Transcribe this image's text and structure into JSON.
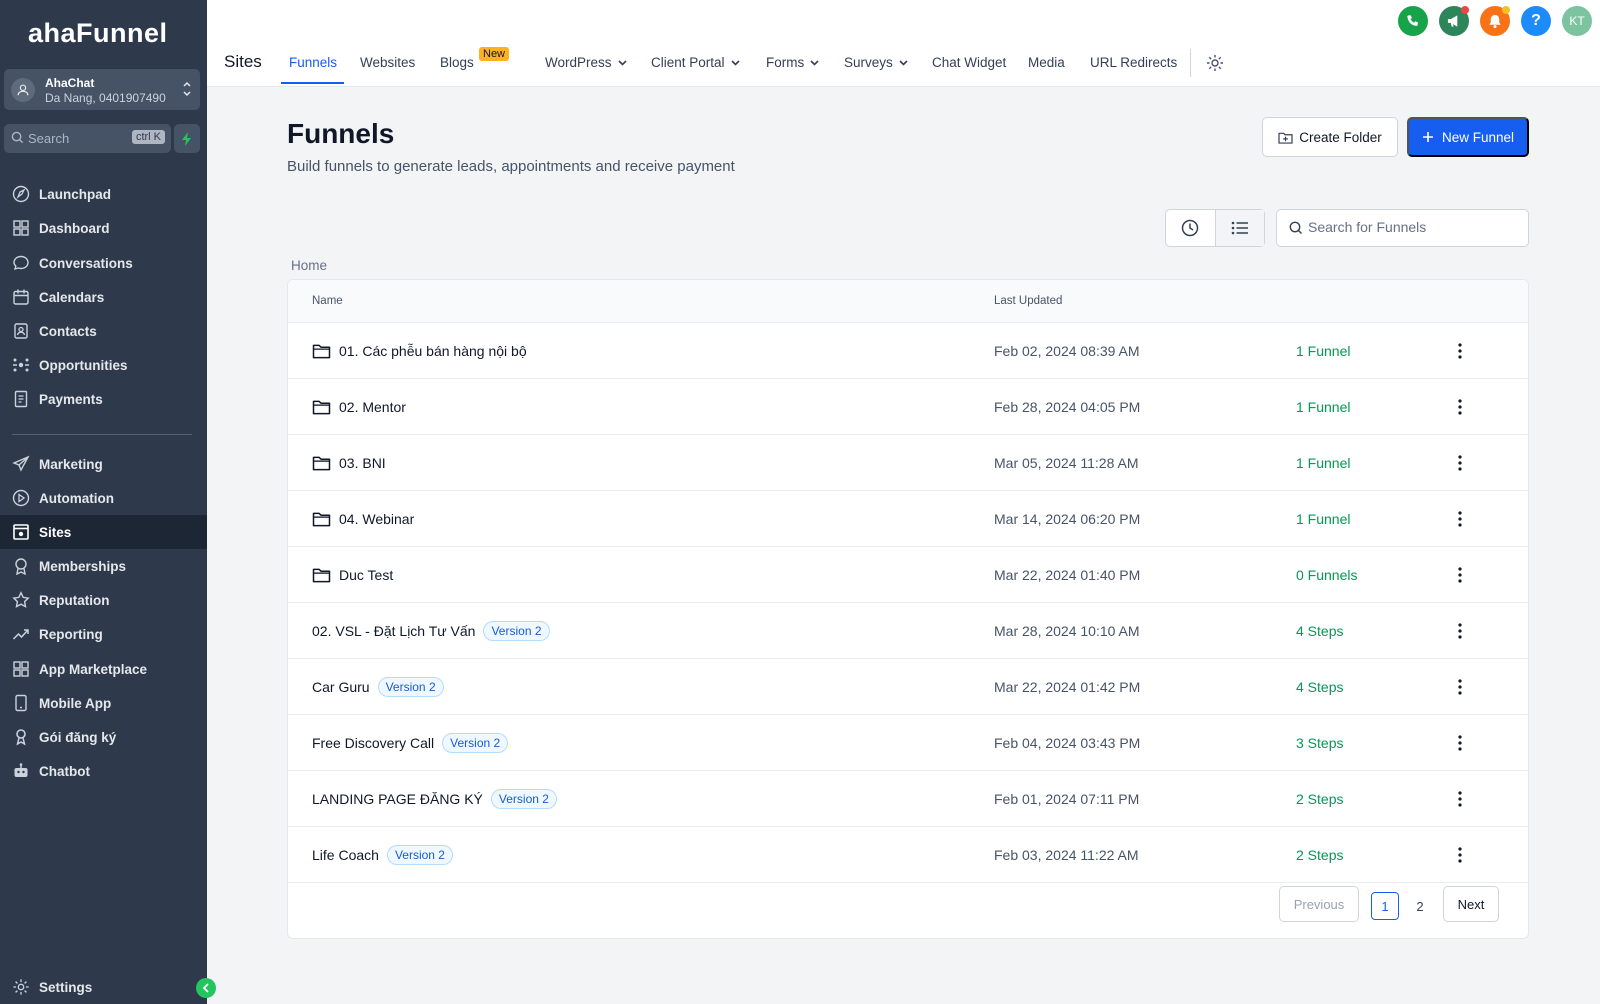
{
  "brand": {
    "logo_text": "ahaFunnel"
  },
  "account": {
    "name": "AhaChat",
    "location": "Da Nang, 0401907490"
  },
  "sidebar_search": {
    "label": "Search",
    "shortcut": "ctrl K"
  },
  "sidebar": {
    "items": [
      {
        "label": "Launchpad",
        "icon": "rocket-icon"
      },
      {
        "label": "Dashboard",
        "icon": "grid-icon"
      },
      {
        "label": "Conversations",
        "icon": "chat-icon"
      },
      {
        "label": "Calendars",
        "icon": "calendar-icon"
      },
      {
        "label": "Contacts",
        "icon": "contacts-icon"
      },
      {
        "label": "Opportunities",
        "icon": "opportunities-icon"
      },
      {
        "label": "Payments",
        "icon": "payments-icon"
      },
      {
        "label": "Marketing",
        "icon": "send-icon"
      },
      {
        "label": "Automation",
        "icon": "automation-icon"
      },
      {
        "label": "Sites",
        "icon": "sites-icon"
      },
      {
        "label": "Memberships",
        "icon": "badge-icon"
      },
      {
        "label": "Reputation",
        "icon": "star-icon"
      },
      {
        "label": "Reporting",
        "icon": "trend-icon"
      },
      {
        "label": "App Marketplace",
        "icon": "apps-icon"
      },
      {
        "label": "Mobile App",
        "icon": "mobile-icon"
      },
      {
        "label": "Gói đăng ký",
        "icon": "subscription-icon"
      },
      {
        "label": "Chatbot",
        "icon": "robot-icon"
      }
    ],
    "active": "Sites",
    "settings_label": "Settings"
  },
  "topbar": {
    "section": "Sites",
    "tabs": [
      {
        "label": "Funnels",
        "active": true
      },
      {
        "label": "Websites"
      },
      {
        "label": "Blogs",
        "badge": "New"
      },
      {
        "label": "WordPress",
        "dropdown": true
      },
      {
        "label": "Client Portal",
        "dropdown": true
      },
      {
        "label": "Forms",
        "dropdown": true
      },
      {
        "label": "Surveys",
        "dropdown": true
      },
      {
        "label": "Chat Widget"
      },
      {
        "label": "Media"
      },
      {
        "label": "URL Redirects"
      }
    ],
    "user_initials": "KT",
    "colors": {
      "phone": "#16a34a",
      "announce": "#2f855a",
      "bell": "#f97316",
      "help": "#1d8cf8",
      "avatar": "#7cc4a0"
    }
  },
  "main": {
    "title": "Funnels",
    "subtitle": "Build funnels to generate leads, appointments and receive payment",
    "create_folder_label": "Create Folder",
    "new_funnel_label": "New Funnel",
    "search_placeholder": "Search for Funnels",
    "breadcrumb": "Home",
    "columns": {
      "name": "Name",
      "updated": "Last Updated"
    },
    "rows": [
      {
        "name": "01. Các phễu bán hàng nội bộ",
        "type": "folder",
        "updated": "Feb 02, 2024 08:39 AM",
        "count": "1 Funnel"
      },
      {
        "name": "02. Mentor",
        "type": "folder",
        "updated": "Feb 28, 2024 04:05 PM",
        "count": "1 Funnel"
      },
      {
        "name": "03. BNI",
        "type": "folder",
        "updated": "Mar 05, 2024 11:28 AM",
        "count": "1 Funnel"
      },
      {
        "name": "04. Webinar",
        "type": "folder",
        "updated": "Mar 14, 2024 06:20 PM",
        "count": "1 Funnel"
      },
      {
        "name": "Duc Test",
        "type": "folder",
        "updated": "Mar 22, 2024 01:40 PM",
        "count": "0 Funnels"
      },
      {
        "name": "02. VSL - Đặt Lịch Tư Vấn",
        "type": "funnel",
        "version": "Version 2",
        "updated": "Mar 28, 2024 10:10 AM",
        "count": "4 Steps"
      },
      {
        "name": "Car Guru",
        "type": "funnel",
        "version": "Version 2",
        "updated": "Mar 22, 2024 01:42 PM",
        "count": "4 Steps"
      },
      {
        "name": "Free Discovery Call",
        "type": "funnel",
        "version": "Version 2",
        "updated": "Feb 04, 2024 03:43 PM",
        "count": "3 Steps"
      },
      {
        "name": "LANDING PAGE ĐĂNG KÝ",
        "type": "funnel",
        "version": "Version 2",
        "updated": "Feb 01, 2024 07:11 PM",
        "count": "2 Steps"
      },
      {
        "name": "Life Coach",
        "type": "funnel",
        "version": "Version 2",
        "updated": "Feb 03, 2024 11:22 AM",
        "count": "2 Steps"
      }
    ],
    "pagination": {
      "previous": "Previous",
      "pages": [
        "1",
        "2"
      ],
      "current": "1",
      "next": "Next"
    }
  }
}
